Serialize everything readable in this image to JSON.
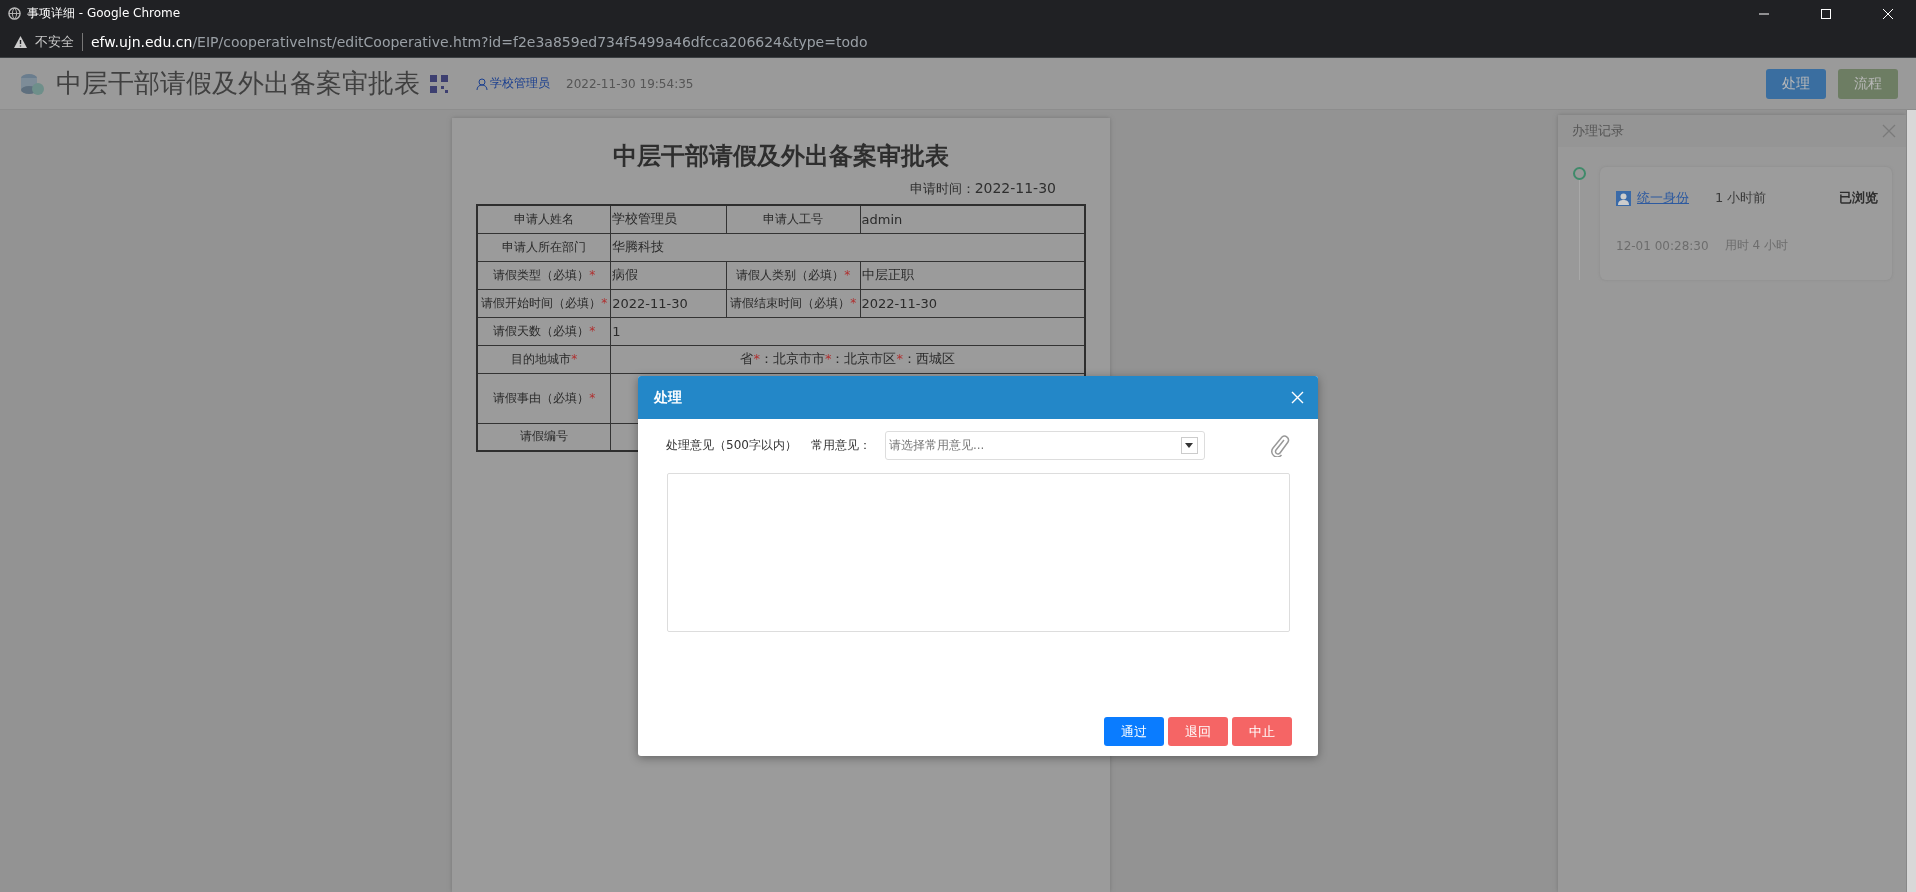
{
  "browser": {
    "title": "事项详细 - Google Chrome",
    "security": "不安全",
    "url_host": "efw.ujn.edu.cn",
    "url_path": "/EIP/cooperativeInst/editCooperative.htm?id=f2e3a859ed734f5499a46dfcca206624&type=todo"
  },
  "header": {
    "title": "中层干部请假及外出备案审批表",
    "user": "学校管理员",
    "time": "2022-11-30 19:54:35",
    "buttons": [
      {
        "label": "处理",
        "kind": "primary"
      },
      {
        "label": "流程",
        "kind": "secondary"
      }
    ]
  },
  "form": {
    "title": "中层干部请假及外出备案审批表",
    "date_label": "申请时间：",
    "date": "2022-11-30",
    "rows": [
      {
        "kind": "pair",
        "cells": [
          {
            "label": "申请人姓名",
            "value": "学校管理员"
          },
          {
            "label": "申请人工号",
            "value": "admin"
          }
        ]
      },
      {
        "kind": "wide",
        "cells": [
          {
            "label": "申请人所在部门",
            "value": "华腾科技"
          }
        ]
      },
      {
        "kind": "pair",
        "cells": [
          {
            "label": "请假类型（必填）",
            "mark": "*",
            "value": "病假"
          },
          {
            "label": "请假人类别（必填）",
            "mark": "*",
            "value": "中层正职"
          }
        ]
      },
      {
        "kind": "pair",
        "cells": [
          {
            "label": "请假开始时间（必填）",
            "mark": "*",
            "value": "2022-11-30"
          },
          {
            "label": "请假结束时间（必填）",
            "mark": "*",
            "value": "2022-11-30"
          }
        ]
      },
      {
        "kind": "wide",
        "cells": [
          {
            "label": "请假天数（必填）",
            "mark": "*",
            "value": "1"
          }
        ]
      },
      {
        "kind": "place",
        "cells": [
          {
            "label": "目的地城市",
            "mark": "*",
            "parts": [
              {
                "text": "省",
                "mark": "*"
              },
              {
                "text": "：北京市市",
                "mark": "*"
              },
              {
                "text": "：北京市区",
                "mark": "*"
              },
              {
                "text": "：西城区"
              }
            ]
          }
        ]
      },
      {
        "kind": "tall",
        "cells": [
          {
            "label": "请假事由（必填）",
            "mark": "*"
          }
        ]
      },
      {
        "kind": "wide",
        "cells": [
          {
            "label": "请假编号"
          }
        ]
      }
    ]
  },
  "record_panel": {
    "title": "办理记录",
    "entries": [
      {
        "user": "统一身份",
        "ago": "1 小时前",
        "status": "已浏览",
        "time": "12-01 00:28:30",
        "duration": "用时 4 小时"
      }
    ]
  },
  "dialog": {
    "title": "处理",
    "opinion_label": "处理意见（500字以内）",
    "common_label": "常用意见：",
    "common_placeholder": "请选择常用意见...",
    "buttons": [
      {
        "label": "通过",
        "kind": "pass"
      },
      {
        "label": "退回",
        "kind": "reject"
      },
      {
        "label": "中止",
        "kind": "reject"
      }
    ]
  }
}
